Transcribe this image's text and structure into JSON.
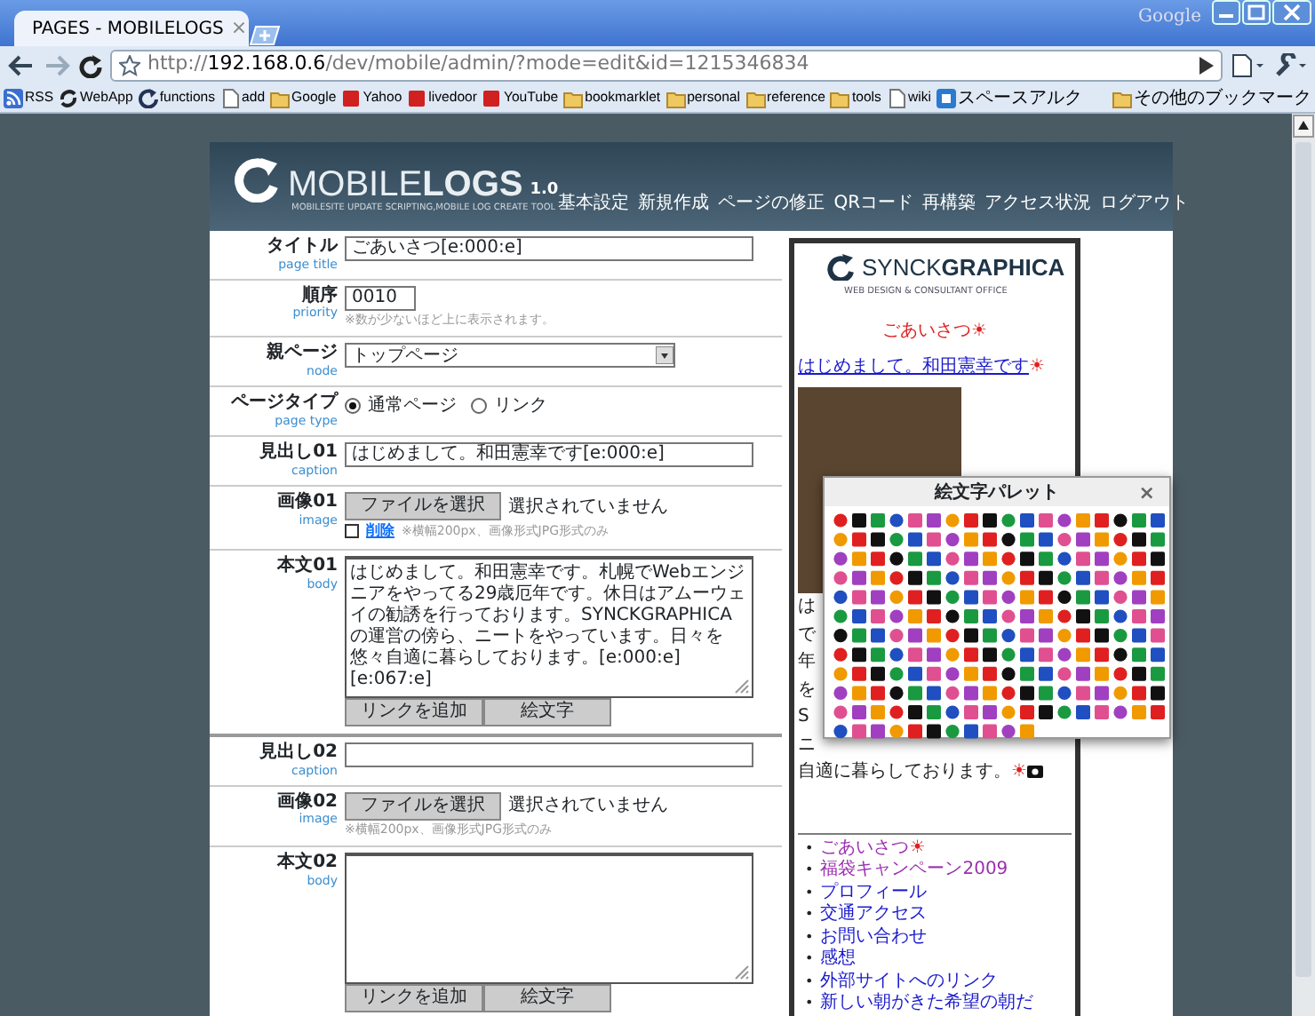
{
  "browser": {
    "tab_title": "PAGES - MOBILELOGS",
    "tab_close": "×",
    "brand": "Google",
    "url": "http://**192.168.0.6**/dev/mobile/admin/?mode=edit&id=1215346834",
    "bookmarks": [
      {
        "label": "RSS",
        "kind": "rss"
      },
      {
        "label": "WebApp",
        "kind": "sync"
      },
      {
        "label": "functions",
        "kind": "reload"
      },
      {
        "label": "add",
        "kind": "page"
      },
      {
        "label": "Google",
        "kind": "folder"
      },
      {
        "label": "Yahoo",
        "kind": "mark"
      },
      {
        "label": "livedoor",
        "kind": "mark"
      },
      {
        "label": "YouTube",
        "kind": "mark"
      },
      {
        "label": "bookmarklet",
        "kind": "folder"
      },
      {
        "label": "personal",
        "kind": "folder"
      },
      {
        "label": "reference",
        "kind": "folder"
      },
      {
        "label": "tools",
        "kind": "folder"
      },
      {
        "label": "wiki",
        "kind": "page"
      },
      {
        "label": "スペースアルク",
        "kind": "app"
      }
    ],
    "other_bookmarks": "その他のブックマーク"
  },
  "header": {
    "logo": "MOBILE**LOGS**",
    "version": "1.0",
    "tagline": "MOBILESITE UPDATE SCRIPTING,MOBILE LOG CREATE TOOL",
    "nav": [
      "基本設定",
      "新規作成",
      "ページの修正",
      "QRコード",
      "再構築",
      "アクセス状況",
      "ログアウト"
    ]
  },
  "form": [
    {
      "kind": "text",
      "label": "タイトル",
      "sublabel": "page title",
      "value": "ごあいさつ[e:000:e]"
    },
    {
      "kind": "number",
      "label": "順序",
      "sublabel": "priority",
      "value": "0010",
      "note": "※数が少ないほど上に表示されます。"
    },
    {
      "kind": "select",
      "label": "親ページ",
      "sublabel": "node",
      "value": "トップページ"
    },
    {
      "kind": "radio",
      "label": "ページタイプ",
      "sublabel": "page type",
      "options": [
        {
          "label": "通常ページ",
          "selected": true
        },
        {
          "label": "リンク",
          "selected": false
        }
      ]
    },
    {
      "kind": "text",
      "label": "見出し01",
      "sublabel": "caption",
      "value": "はじめまして。和田憲幸です[e:000:e]"
    },
    {
      "kind": "file",
      "label": "画像01",
      "sublabel": "image",
      "button": "ファイルを選択",
      "status": "選択されていません",
      "delete": {
        "label": "削除",
        "checked": false
      },
      "note": "※横幅200px、画像形式JPG形式のみ"
    },
    {
      "kind": "textarea",
      "label": "本文01",
      "sublabel": "body",
      "value": "はじめまして。和田憲幸です。札幌でWebエンジニアをやってる29歳厄年です。休日はアムーウェイの勧誘を行っております。SYNCKGRAPHICAの運営の傍ら、ニートをやっています。日々を悠々自適に暮らしております。[e:000:e][e:067:e]",
      "buttons": [
        "リンクを追加",
        "絵文字"
      ]
    },
    {
      "kind": "text",
      "label": "見出し02",
      "sublabel": "caption"
    },
    {
      "kind": "file",
      "label": "画像02",
      "sublabel": "image",
      "button": "ファイルを選択",
      "status": "選択されていません",
      "note": "※横幅200px、画像形式JPG形式のみ"
    },
    {
      "kind": "textarea",
      "label": "本文02",
      "sublabel": "body",
      "buttons": [
        "リンクを追加",
        "絵文字"
      ]
    }
  ],
  "preview": {
    "logo": "SYNCK**GRAPHICA**",
    "tagline": "WEB DESIGN & CONSULTANT OFFICE",
    "title": "ごあいさつ",
    "title_mark": "☀",
    "heading": "はじめまして。和田憲幸です",
    "heading_mark": "☀",
    "body_lines": [
      "は",
      "で",
      "年",
      "を",
      "S",
      "ニ"
    ],
    "closing": "自適に暮らしております。",
    "closing_mark": "☀",
    "bullet": "•",
    "links": [
      {
        "label": "ごあいさつ",
        "visited": true,
        "mark": "☀"
      },
      {
        "label": "福袋キャンペーン2009",
        "visited": true
      },
      {
        "label": "プロフィール",
        "visited": false
      },
      {
        "label": "交通アクセス",
        "visited": false
      },
      {
        "label": "お問い合わせ",
        "visited": false
      },
      {
        "label": "感想",
        "visited": false
      },
      {
        "label": "外部サイトへのリンク",
        "visited": false
      },
      {
        "label": "新しい朝がきた希望の朝だ",
        "visited": false
      }
    ]
  },
  "palette": {
    "title": "絵文字パレット",
    "close": "×"
  }
}
